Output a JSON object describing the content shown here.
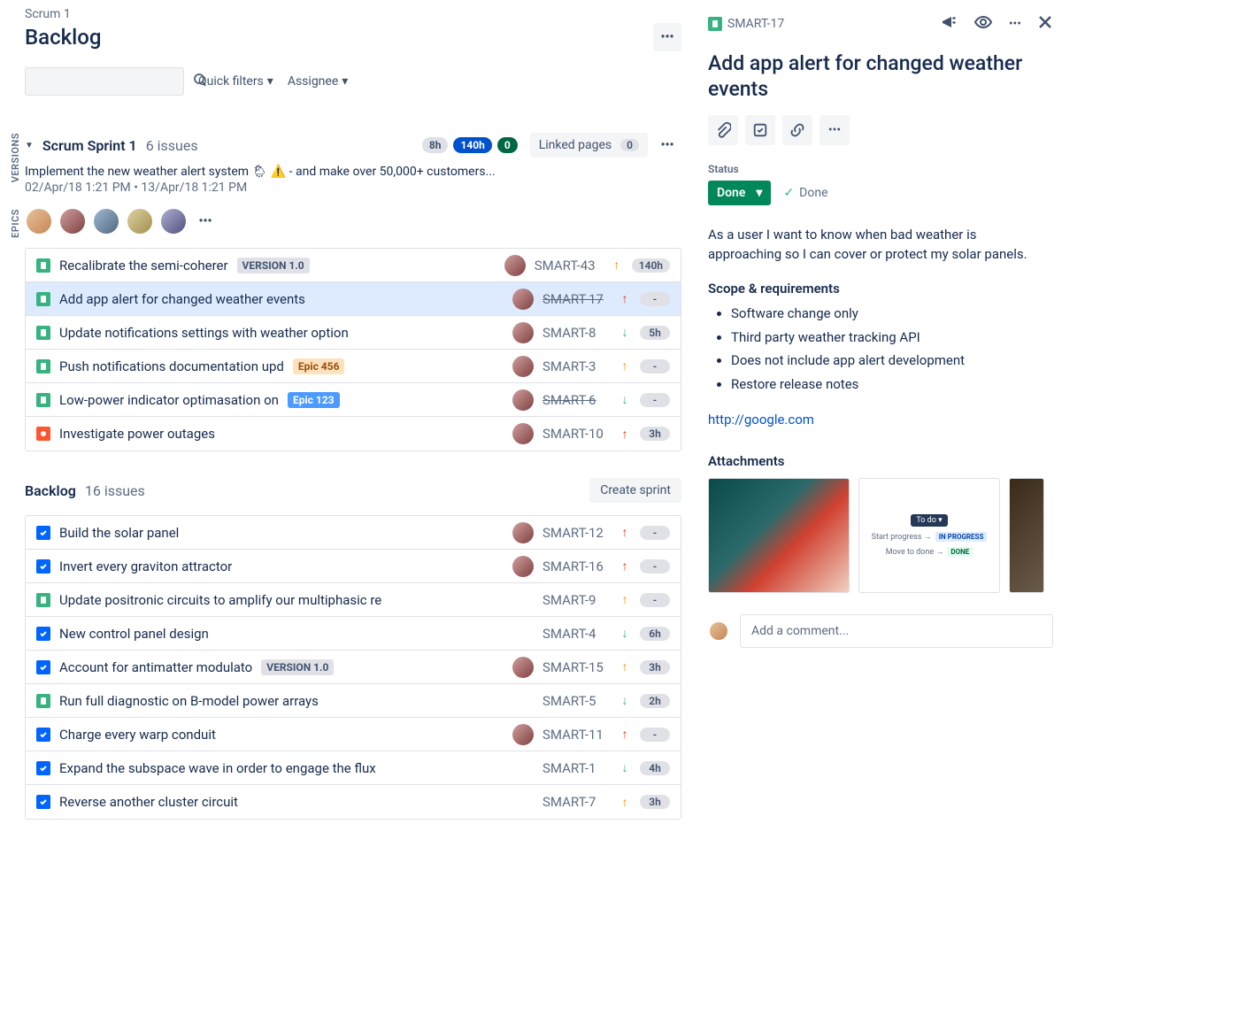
{
  "breadcrumb": "Scrum 1",
  "page_title": "Backlog",
  "filters": {
    "quick": "Quick filters",
    "assignee": "Assignee"
  },
  "sprint": {
    "name": "Scrum Sprint 1",
    "count_label": "6 issues",
    "est_todo": "8h",
    "est_inprog": "140h",
    "est_done": "0",
    "linked_label": "Linked pages",
    "linked_count": "0",
    "goal": "Implement the new weather alert system 🌦 ⚠️ - and make over 50,000+ customers...",
    "dates": "02/Apr/18 1:21 PM • 13/Apr/18 1:21 PM",
    "items": [
      {
        "type": "story",
        "title": "Recalibrate the semi-coherer",
        "epic": "VERSION 1.0",
        "epic_style": "grey",
        "avatar": true,
        "key": "SMART-43",
        "strike": false,
        "prio": "up-orange",
        "est": "140h"
      },
      {
        "type": "story",
        "title": "Add app alert for changed weather events",
        "epic": "",
        "avatar": true,
        "key": "SMART-17",
        "strike": true,
        "prio": "up-red",
        "est": "-",
        "selected": true
      },
      {
        "type": "story",
        "title": "Update notifications settings with weather option",
        "epic": "",
        "avatar": true,
        "key": "SMART-8",
        "strike": false,
        "prio": "down-green",
        "est": "5h"
      },
      {
        "type": "story",
        "title": "Push notifications documentation upd",
        "epic": "Epic 456",
        "epic_style": "orange",
        "avatar": true,
        "key": "SMART-3",
        "strike": false,
        "prio": "up-orange",
        "est": "-"
      },
      {
        "type": "story",
        "title": "Low-power indicator optimasation on",
        "epic": "Epic 123",
        "epic_style": "blue",
        "avatar": true,
        "key": "SMART-6",
        "strike": true,
        "prio": "down-green",
        "est": "-"
      },
      {
        "type": "bug",
        "title": "Investigate power outages",
        "epic": "",
        "avatar": true,
        "key": "SMART-10",
        "strike": false,
        "prio": "up-red",
        "est": "3h"
      }
    ]
  },
  "backlog": {
    "name": "Backlog",
    "count_label": "16 issues",
    "create_sprint": "Create sprint",
    "items": [
      {
        "type": "task",
        "title": "Build the solar panel",
        "epic": "",
        "avatar": true,
        "key": "SMART-12",
        "strike": false,
        "prio": "up-red",
        "est": "-"
      },
      {
        "type": "task",
        "title": "Invert every graviton attractor",
        "epic": "",
        "avatar": true,
        "key": "SMART-16",
        "strike": false,
        "prio": "up-red",
        "est": "-"
      },
      {
        "type": "story",
        "title": "Update positronic circuits to amplify our multiphasic re",
        "epic": "",
        "avatar": false,
        "key": "SMART-9",
        "strike": false,
        "prio": "up-orange",
        "est": "-"
      },
      {
        "type": "task",
        "title": "New control panel design",
        "epic": "",
        "avatar": false,
        "key": "SMART-4",
        "strike": false,
        "prio": "down-green",
        "est": "6h"
      },
      {
        "type": "task",
        "title": "Account for antimatter modulato",
        "epic": "VERSION 1.0",
        "epic_style": "grey",
        "avatar": true,
        "key": "SMART-15",
        "strike": false,
        "prio": "up-orange",
        "est": "3h"
      },
      {
        "type": "story",
        "title": "Run full diagnostic on B-model power arrays",
        "epic": "",
        "avatar": false,
        "key": "SMART-5",
        "strike": false,
        "prio": "down-green",
        "est": "2h"
      },
      {
        "type": "task",
        "title": "Charge every warp conduit",
        "epic": "",
        "avatar": true,
        "key": "SMART-11",
        "strike": false,
        "prio": "up-red",
        "est": "-"
      },
      {
        "type": "task",
        "title": "Expand the subspace wave in order to engage the flux",
        "epic": "",
        "avatar": false,
        "key": "SMART-1",
        "strike": false,
        "prio": "down-green",
        "est": "4h"
      },
      {
        "type": "task",
        "title": "Reverse another cluster circuit",
        "epic": "",
        "avatar": false,
        "key": "SMART-7",
        "strike": false,
        "prio": "up-orange",
        "est": "3h"
      }
    ]
  },
  "sidebar": {
    "versions": "VERSIONS",
    "epics": "EPICS"
  },
  "detail": {
    "key": "SMART-17",
    "title": "Add app alert for changed weather events",
    "status_label": "Status",
    "status_value": "Done",
    "status_category": "Done",
    "description": "As a user I want to know when bad weather is approaching so I can cover or protect my solar panels.",
    "scope_heading": "Scope & requirements",
    "scope_items": [
      "Software change only",
      "Third party weather tracking API",
      "Does not include app alert development",
      "Restore release notes"
    ],
    "link": "http://google.com",
    "attachments_label": "Attachments",
    "thumb2": {
      "pill": "To do ▾",
      "line1a": "Start progress →",
      "line1b": "IN PROGRESS",
      "line2a": "Move to done →",
      "line2b": "DONE"
    },
    "comment_placeholder": "Add a comment..."
  }
}
